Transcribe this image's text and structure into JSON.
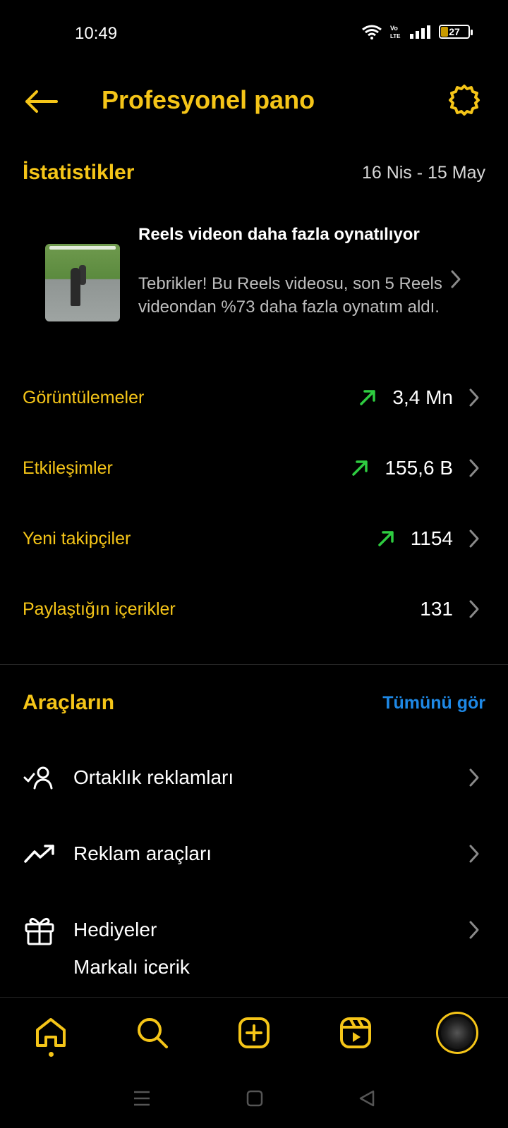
{
  "status_bar": {
    "time": "10:49",
    "battery": "27",
    "battery_level_percent": 27,
    "network_label": "Vo LTE"
  },
  "header": {
    "title": "Profesyonel pano",
    "back_icon": "arrow-left-icon",
    "settings_icon": "gear-icon"
  },
  "stats": {
    "title": "İstatistikler",
    "date_range": "16 Nis - 15 May",
    "highlight": {
      "title": "Reels videon daha fazla oynatılıyor",
      "description": "Tebrikler! Bu Reels videosu, son 5 Reels videondan %73 daha fazla oynatım aldı."
    },
    "rows": [
      {
        "label": "Görüntülemeler",
        "value": "3,4 Mn",
        "trend": "up"
      },
      {
        "label": "Etkileşimler",
        "value": "155,6 B",
        "trend": "up"
      },
      {
        "label": "Yeni takipçiler",
        "value": "1154",
        "trend": "up"
      },
      {
        "label": "Paylaştığın içerikler",
        "value": "131",
        "trend": "none"
      }
    ]
  },
  "tools": {
    "title": "Araçların",
    "see_all": "Tümünü gör",
    "items": [
      {
        "label": "Ortaklık reklamları",
        "icon": "partnership-user-check-icon"
      },
      {
        "label": "Reklam araçları",
        "icon": "trending-up-icon"
      },
      {
        "label": "Hediyeler",
        "icon": "gift-icon"
      },
      {
        "label": "Markalı içerik",
        "icon": ""
      }
    ]
  },
  "bottom_nav": {
    "items": [
      "home-icon",
      "search-icon",
      "create-plus-icon",
      "reels-icon",
      "profile-avatar"
    ],
    "active": "home-icon"
  },
  "colors": {
    "accent": "#f5c518",
    "link": "#1e88e5",
    "trend_up": "#2ecc40",
    "background": "#000000"
  }
}
